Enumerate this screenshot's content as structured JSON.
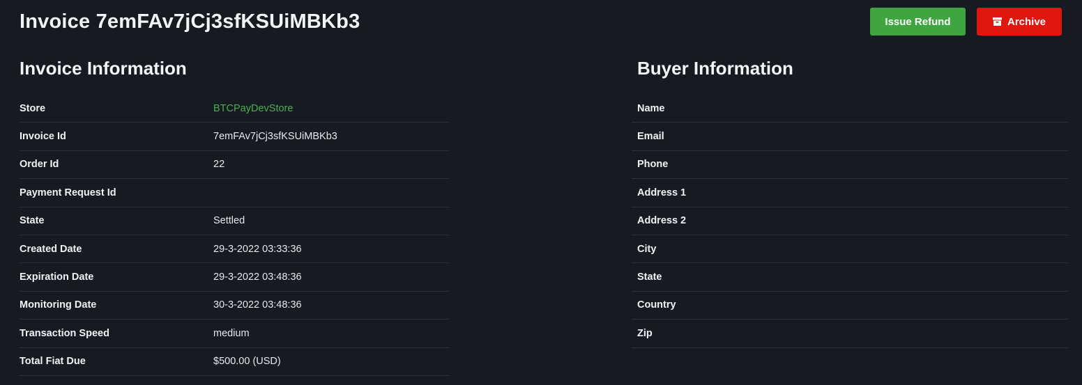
{
  "header": {
    "title": "Invoice 7emFAv7jCj3sfKSUiMBKb3",
    "refund_label": "Issue Refund",
    "archive_label": "Archive"
  },
  "invoice_info": {
    "title": "Invoice Information",
    "rows": [
      {
        "label": "Store",
        "value": "BTCPayDevStore"
      },
      {
        "label": "Invoice Id",
        "value": "7emFAv7jCj3sfKSUiMBKb3"
      },
      {
        "label": "Order Id",
        "value": "22"
      },
      {
        "label": "Payment Request Id",
        "value": ""
      },
      {
        "label": "State",
        "value": "Settled"
      },
      {
        "label": "Created Date",
        "value": "29-3-2022 03:33:36"
      },
      {
        "label": "Expiration Date",
        "value": "29-3-2022 03:48:36"
      },
      {
        "label": "Monitoring Date",
        "value": "30-3-2022 03:48:36"
      },
      {
        "label": "Transaction Speed",
        "value": "medium"
      },
      {
        "label": "Total Fiat Due",
        "value": "$500.00 (USD)"
      }
    ]
  },
  "buyer_info": {
    "title": "Buyer Information",
    "rows": [
      {
        "label": "Name",
        "value": ""
      },
      {
        "label": "Email",
        "value": ""
      },
      {
        "label": "Phone",
        "value": ""
      },
      {
        "label": "Address 1",
        "value": ""
      },
      {
        "label": "Address 2",
        "value": ""
      },
      {
        "label": "City",
        "value": ""
      },
      {
        "label": "State",
        "value": ""
      },
      {
        "label": "Country",
        "value": ""
      },
      {
        "label": "Zip",
        "value": ""
      }
    ]
  },
  "colors": {
    "background": "#161b22",
    "refund_button": "#3fa541",
    "archive_button": "#e0170f",
    "link": "#4caf50"
  },
  "icons": {
    "archive": "archive-box-icon"
  }
}
